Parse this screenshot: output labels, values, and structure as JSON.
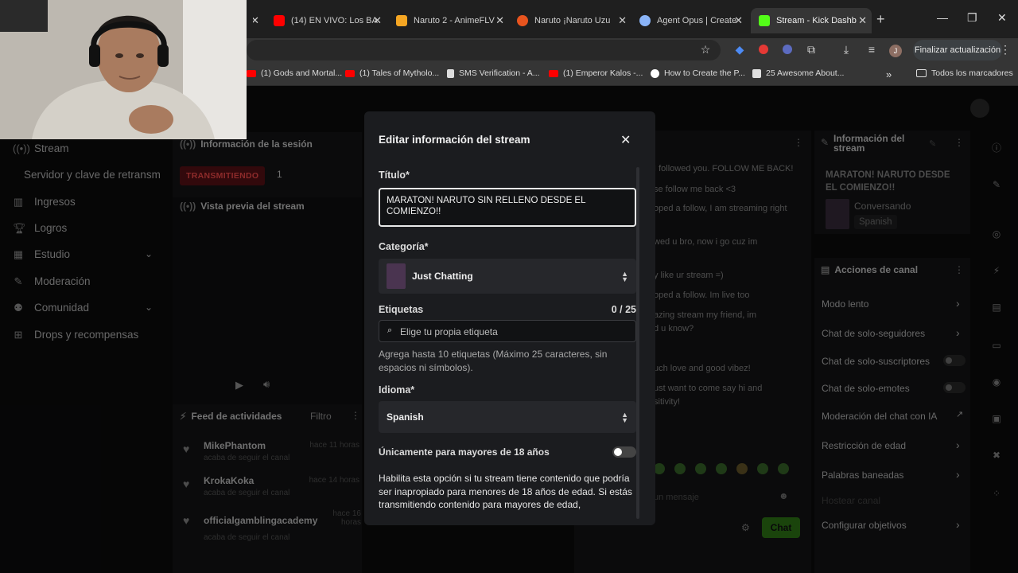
{
  "browser": {
    "tabs": [
      {
        "label": "(14) EN VIVO: Los BA",
        "color": "#ff0000"
      },
      {
        "label": "Naruto 2 - AnimeFLV",
        "color": "#f5a623"
      },
      {
        "label": "Naruto ¡Naruto Uzu",
        "color": "#e8541e"
      },
      {
        "label": "Agent Opus | Create",
        "color": "#8ab4f8"
      },
      {
        "label": "Stream - Kick Dashb",
        "color": "#53fc18"
      }
    ],
    "update_button": "Finalizar actualización",
    "profile_initial": "J",
    "bookmarks": [
      {
        "label": "(1) Gods and Mortal..."
      },
      {
        "label": "(1) Tales of Mytholo..."
      },
      {
        "label": "SMS Verification - A..."
      },
      {
        "label": "(1) Emperor Kalos -..."
      },
      {
        "label": "How to Create the P..."
      },
      {
        "label": "25 Awesome About..."
      }
    ],
    "all_bookmarks": "Todos los marcadores"
  },
  "sidebar": {
    "items": [
      {
        "label": "Stream"
      },
      {
        "label": "Servidor y clave de retransm"
      },
      {
        "label": "Ingresos"
      },
      {
        "label": "Logros"
      },
      {
        "label": "Estudio"
      },
      {
        "label": "Moderación"
      },
      {
        "label": "Comunidad"
      },
      {
        "label": "Drops y recompensas"
      }
    ]
  },
  "session": {
    "title": "Información de la sesión",
    "live_badge": "TRANSMITIENDO",
    "viewers": "1",
    "preview_title": "Vista previa del stream"
  },
  "feed": {
    "title": "Feed de actividades",
    "filter": "Filtro",
    "rows": [
      {
        "name": "MikePhantom",
        "sub": "acaba de seguir el canal",
        "time": "hace 11 horas"
      },
      {
        "name": "KrokaKoka",
        "sub": "acaba de seguir el canal",
        "time": "hace 14 horas"
      },
      {
        "name": "officialgamblingacademy",
        "sub": "acaba de seguir el canal",
        "time": "hace 16 horas"
      }
    ]
  },
  "chat": {
    "lines": [
      "I followed you. FOLLOW ME BACK!",
      "se follow me back <3",
      "oped a follow, I am streaming right",
      "wed u bro, now i go cuz im",
      "y like ur stream =)",
      "oped a follow. Im live too",
      "azing stream my friend, im",
      "d u know?",
      "uch love and good vibez!",
      "ust want to come say hi and",
      "sitivity!"
    ],
    "input_placeholder": "un mensaje",
    "send_button": "Chat"
  },
  "stream_info": {
    "title": "Información del stream",
    "stream_title": "MARATON! NARUTO DESDE EL COMIENZO!!",
    "category": "Conversando",
    "language": "Spanish"
  },
  "channel_actions": {
    "title": "Acciones de canal",
    "items": [
      {
        "label": "Modo lento",
        "control": "arrow"
      },
      {
        "label": "Chat de solo-seguidores",
        "control": "arrow"
      },
      {
        "label": "Chat de solo-suscriptores",
        "control": "toggle"
      },
      {
        "label": "Chat de solo-emotes",
        "control": "toggle"
      },
      {
        "label": "Moderación del chat con IA",
        "control": "external"
      },
      {
        "label": "Restricción de edad",
        "control": "arrow"
      },
      {
        "label": "Palabras baneadas",
        "control": "arrow"
      },
      {
        "label": "Hostear canal",
        "control": "none"
      },
      {
        "label": "Configurar objetivos",
        "control": "arrow"
      }
    ]
  },
  "modal": {
    "title": "Editar información del stream",
    "title_label": "Título*",
    "title_value": "MARATON! NARUTO SIN RELLENO DESDE EL COMIENZO!!",
    "category_label": "Categoría*",
    "category_value": "Just Chatting",
    "tags_label": "Etiquetas",
    "tags_count": "0 / 25",
    "tags_placeholder": "Elige tu propia etiqueta",
    "tags_help": "Agrega hasta 10 etiquetas (Máximo 25 caracteres, sin espacios ni símbolos).",
    "language_label": "Idioma*",
    "language_value": "Spanish",
    "mature_label": "Únicamente para mayores de 18 años",
    "mature_enabled": false,
    "mature_help": "Habilita esta opción si tu stream tiene contenido que podría ser inapropiado para menores de 18 años de edad. Si estás transmitiendo contenido para mayores de edad,"
  },
  "colors": {
    "accent": "#53fc18",
    "live_red": "#ff4d4d",
    "modal_bg": "#1b1c1f"
  }
}
